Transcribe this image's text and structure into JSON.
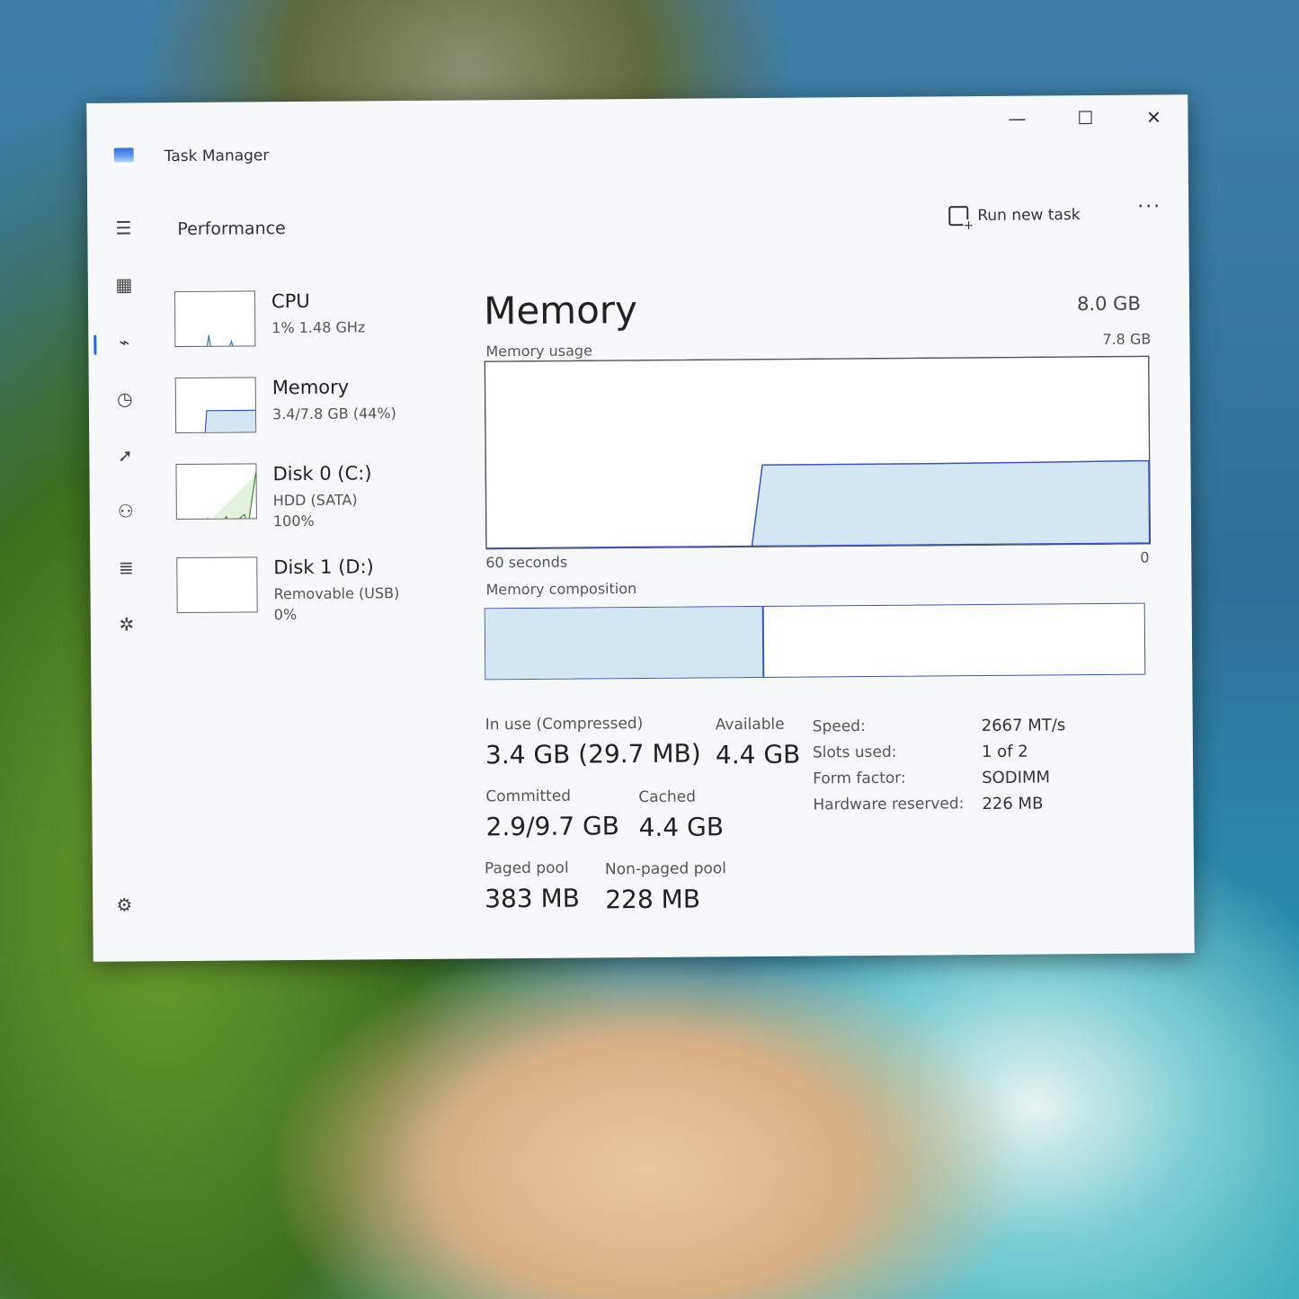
{
  "window": {
    "title": "Task Manager"
  },
  "controls": {
    "minimize": "—",
    "maximize": "☐",
    "close": "✕"
  },
  "nav_icons": [
    "hamburger-icon",
    "processes-icon",
    "performance-icon",
    "app-history-icon",
    "startup-icon",
    "users-icon",
    "details-icon",
    "services-icon"
  ],
  "section_title": "Performance",
  "toolbar": {
    "run_new_task": "Run new task",
    "more": "···"
  },
  "devices": [
    {
      "name": "CPU",
      "line1": "1% 1.48 GHz",
      "line2": ""
    },
    {
      "name": "Memory",
      "line1": "3.4/7.8 GB (44%)",
      "line2": ""
    },
    {
      "name": "Disk 0 (C:)",
      "line1": "HDD (SATA)",
      "line2": "100%"
    },
    {
      "name": "Disk 1 (D:)",
      "line1": "Removable (USB)",
      "line2": "0%"
    }
  ],
  "main": {
    "title": "Memory",
    "total": "8.0 GB",
    "usage_label": "Memory usage",
    "usage_max": "7.8 GB",
    "time_left": "60 seconds",
    "time_right": "0",
    "composition_label": "Memory composition"
  },
  "chart_data": {
    "type": "area",
    "title": "Memory usage",
    "xlabel": "",
    "ylabel": "",
    "x_range_label": [
      "60 seconds",
      "0"
    ],
    "ylim": [
      0,
      7.8
    ],
    "x": [
      60,
      48,
      36,
      35,
      30,
      20,
      10,
      0
    ],
    "values": [
      0,
      0,
      0,
      3.4,
      3.4,
      3.4,
      3.42,
      3.45
    ],
    "color": "#d4e6f2",
    "line_color": "#3b55b5",
    "composition": {
      "in_use_fraction": 0.42
    }
  },
  "stats": {
    "in_use_label": "In use (Compressed)",
    "in_use_value": "3.4 GB (29.7 MB)",
    "available_label": "Available",
    "available_value": "4.4 GB",
    "committed_label": "Committed",
    "committed_value": "2.9/9.7 GB",
    "cached_label": "Cached",
    "cached_value": "4.4 GB",
    "paged_label": "Paged pool",
    "paged_value": "383 MB",
    "nonpaged_label": "Non-paged pool",
    "nonpaged_value": "228 MB"
  },
  "details": [
    {
      "label": "Speed:",
      "value": "2667 MT/s"
    },
    {
      "label": "Slots used:",
      "value": "1 of 2"
    },
    {
      "label": "Form factor:",
      "value": "SODIMM"
    },
    {
      "label": "Hardware reserved:",
      "value": "226 MB"
    }
  ]
}
